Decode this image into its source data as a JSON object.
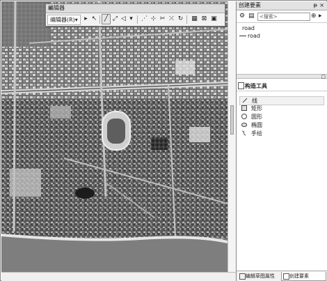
{
  "editor_toolbar": {
    "title": "编辑器",
    "close_glyph": "×",
    "menu_label": "编辑器(R)▾",
    "buttons": [
      {
        "name": "edit-tool-icon",
        "glyph": "▸"
      },
      {
        "name": "edit-annotation-icon",
        "glyph": "↖"
      },
      {
        "name": "straight-segment-icon",
        "glyph": "╱"
      },
      {
        "name": "trace-icon",
        "glyph": "⤢"
      },
      {
        "name": "point-tool-icon",
        "glyph": "◁"
      },
      {
        "name": "dropdown-arrow-icon",
        "glyph": "▾"
      },
      {
        "name": "edit-vertices-icon",
        "glyph": "⋰"
      },
      {
        "name": "reshape-feature-icon",
        "glyph": "⊹"
      },
      {
        "name": "cut-polygon-icon",
        "glyph": "✂"
      },
      {
        "name": "split-tool-icon",
        "glyph": "⤫"
      },
      {
        "name": "rotate-icon",
        "glyph": "↻"
      },
      {
        "name": "attributes-icon",
        "glyph": "▦"
      },
      {
        "name": "sketch-properties-icon",
        "glyph": "⊠"
      },
      {
        "name": "create-features-icon",
        "glyph": "▣"
      }
    ]
  },
  "create_features_pane": {
    "title": "创建要素",
    "pin_glyph": "ᵽ",
    "close_glyph": "×",
    "search_placeholder": "<搜索>",
    "template_group": "road",
    "template_item": "road",
    "construction_tools_title": "构造工具",
    "tools": [
      {
        "label": "线",
        "icon": "line-tool-icon"
      },
      {
        "label": "矩形",
        "icon": "rectangle-tool-icon"
      },
      {
        "label": "圆形",
        "icon": "circle-tool-icon"
      },
      {
        "label": "椭圆",
        "icon": "ellipse-tool-icon"
      },
      {
        "label": "手绘",
        "icon": "freehand-tool-icon"
      }
    ],
    "bottom_tabs": [
      "编辑草图属性",
      "创建要素"
    ]
  },
  "colors": {
    "toolbar_bg": "#f2f2f2",
    "pane_bg": "#ffffff",
    "road_line": "#4a4a4a"
  }
}
